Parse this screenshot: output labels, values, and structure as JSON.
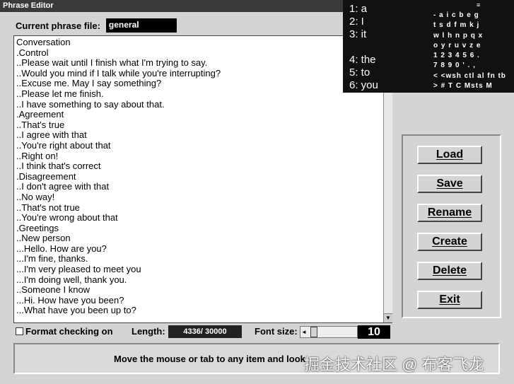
{
  "window": {
    "title": "Phrase Editor"
  },
  "file": {
    "label": "Current phrase file:",
    "value": "general"
  },
  "phrases": [
    "Conversation",
    ".Control",
    "..Please wait until I finish what I'm trying to say.",
    "..Would you mind if I talk while you're interrupting?",
    "..Excuse me. May I say something?",
    "..Please let me finish.",
    "..I have something to say about that.",
    ".Agreement",
    "..That's true",
    "..I agree with that",
    "..You're right about that",
    "..Right on!",
    "..I think that's correct",
    ".Disagreement",
    "..I don't agree with that",
    "..No way!",
    "..That's not true",
    "..You're wrong about that",
    ".Greetings",
    "..New person",
    "...Hello. How are you?",
    "...I'm fine, thanks.",
    "...I'm very pleased to meet you",
    "...I'm doing well, thank you.",
    "..Someone I know",
    "...Hi. How have you been?",
    "...What have you been up to?"
  ],
  "keyboard": {
    "predictions": [
      "1: a",
      "2: I",
      "3: it",
      "4: the",
      "5: to",
      "6: you"
    ],
    "top_mark": "≡",
    "key_rows": [
      "- a i c b e g",
      "t s d f m k j",
      "w l h n p q x",
      "o y r u v z e",
      "1 2 3 4 5 6 .",
      "7 8 9 0 ' . ,",
      "< <wsh ctl al fn tb",
      "> # T C Msts M"
    ]
  },
  "buttons": {
    "load": "Load",
    "save": "Save",
    "rename": "Rename",
    "create": "Create",
    "delete": "Delete",
    "exit": "Exit"
  },
  "options": {
    "format_label": "Format checking on",
    "format_checked": false,
    "length_label": "Length:",
    "length_value": "4336/ 30000",
    "font_size_label": "Font size:",
    "font_size_value": "10",
    "slider_left": "◄"
  },
  "scroll_down": "▼",
  "status": {
    "text": "Move the mouse or tab to any item and look"
  },
  "watermark": "掘金技术社区 @ 布客飞龙"
}
